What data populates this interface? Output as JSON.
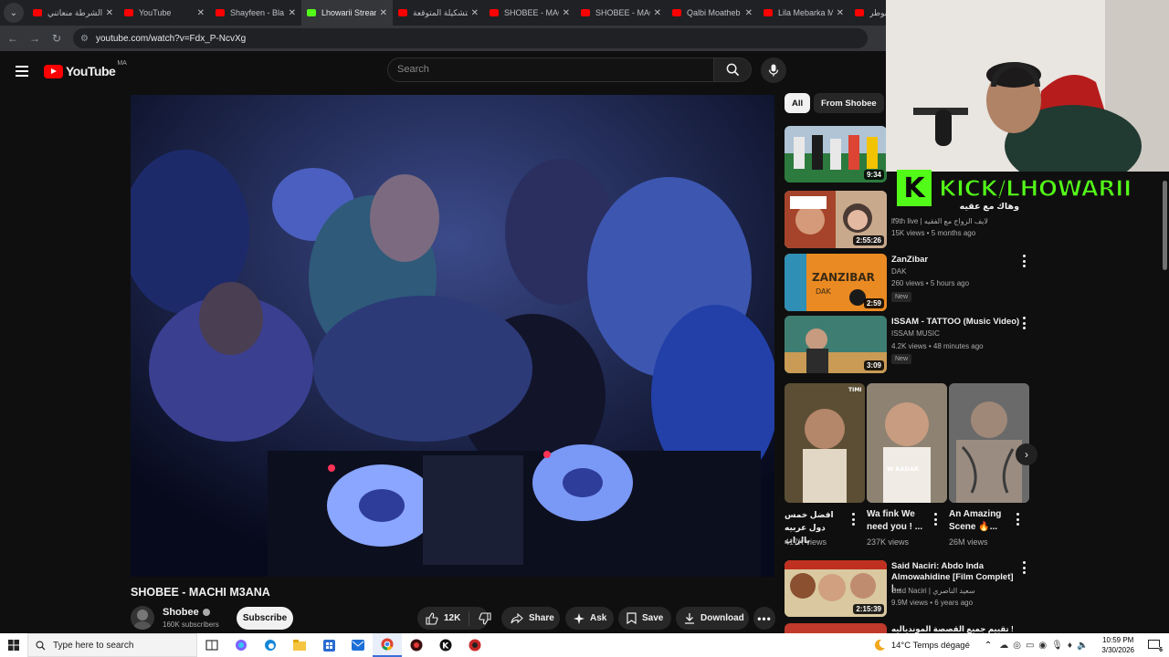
{
  "browser": {
    "tabs": [
      {
        "label": "الشرطة منعاتني",
        "icon": "youtube-icon"
      },
      {
        "label": "YouTube",
        "icon": "youtube-icon"
      },
      {
        "label": "Shayfeen - Bla",
        "icon": "youtube-icon"
      },
      {
        "label": "Lhowarii Stream",
        "icon": "kick-icon",
        "active": true
      },
      {
        "label": "التشكيلة المتوقعة",
        "icon": "youtube-icon"
      },
      {
        "label": "SHOBEE - MAC",
        "icon": "youtube-icon"
      },
      {
        "label": "SHOBEE - MAC",
        "icon": "youtube-icon"
      },
      {
        "label": "Qalbi Moatheb",
        "icon": "youtube-icon"
      },
      {
        "label": "Lila Mebarka M",
        "icon": "youtube-icon"
      },
      {
        "label": "بوطر",
        "icon": "youtube-icon"
      }
    ],
    "url": "youtube.com/watch?v=Fdx_P-NcvXg"
  },
  "youtube": {
    "logo_text": "YouTube",
    "country_code": "MA",
    "search_placeholder": "Search"
  },
  "video": {
    "title": "SHOBEE - MACHI M3ANA",
    "channel": "Shobee",
    "subscribers": "160K subscribers",
    "subscribe_label": "Subscribe",
    "likes": "12K",
    "share_label": "Share",
    "ask_label": "Ask",
    "save_label": "Save",
    "download_label": "Download"
  },
  "filters": {
    "all": "All",
    "from_channel": "From Shobee"
  },
  "related": [
    {
      "title": "",
      "channel": "",
      "meta": "",
      "duration": "9:34"
    },
    {
      "title": "وهاك مع عقيه",
      "channel": "lf9th live | لايف الزواج مع الفقيه",
      "meta": "15K views • 5 months ago",
      "duration": "2:55:26"
    },
    {
      "title": "ZanZibar",
      "channel": "DAK",
      "meta": "260 views • 5 hours ago",
      "duration": "2:59",
      "badge": "New"
    },
    {
      "title": "ISSAM - TATTOO (Music Video)",
      "channel": "ISSAM MUSIC",
      "meta": "4.2K views • 48 minutes ago",
      "duration": "3:09",
      "badge": "New"
    },
    {
      "title": "Said Naciri: Abdo Inda Almowahidine [Film Complet] |...",
      "channel": "Said Naciri | سعيد الناصري",
      "meta": "9.9M views • 6 years ago",
      "duration": "2:15:39"
    },
    {
      "title": "! تقييم جميع القصصة الموندياليه",
      "channel": "",
      "meta": "",
      "duration": ""
    }
  ],
  "shorts": [
    {
      "title": "افضل خمس دول عربيه بالراب",
      "views": "417K views",
      "overlay": "TIMI"
    },
    {
      "title": "Wa fink We need you ! ...",
      "views": "237K views",
      "overlay": "W RADAR"
    },
    {
      "title": "An Amazing Scene 🔥...",
      "views": "26M views",
      "overlay": ""
    }
  ],
  "stream_overlay": {
    "kick_letter": "K",
    "kick_handle": "KICK/LHOWARII"
  },
  "taskbar": {
    "search_placeholder": "Type here to search",
    "weather": "14°C  Temps dégagé",
    "time": "10:59 PM",
    "date": "3/30/2026",
    "notifications": "6"
  },
  "colors": {
    "youtube_red": "#ff0000",
    "kick_green": "#53fc18",
    "dark_bg": "#0f0f0f"
  }
}
